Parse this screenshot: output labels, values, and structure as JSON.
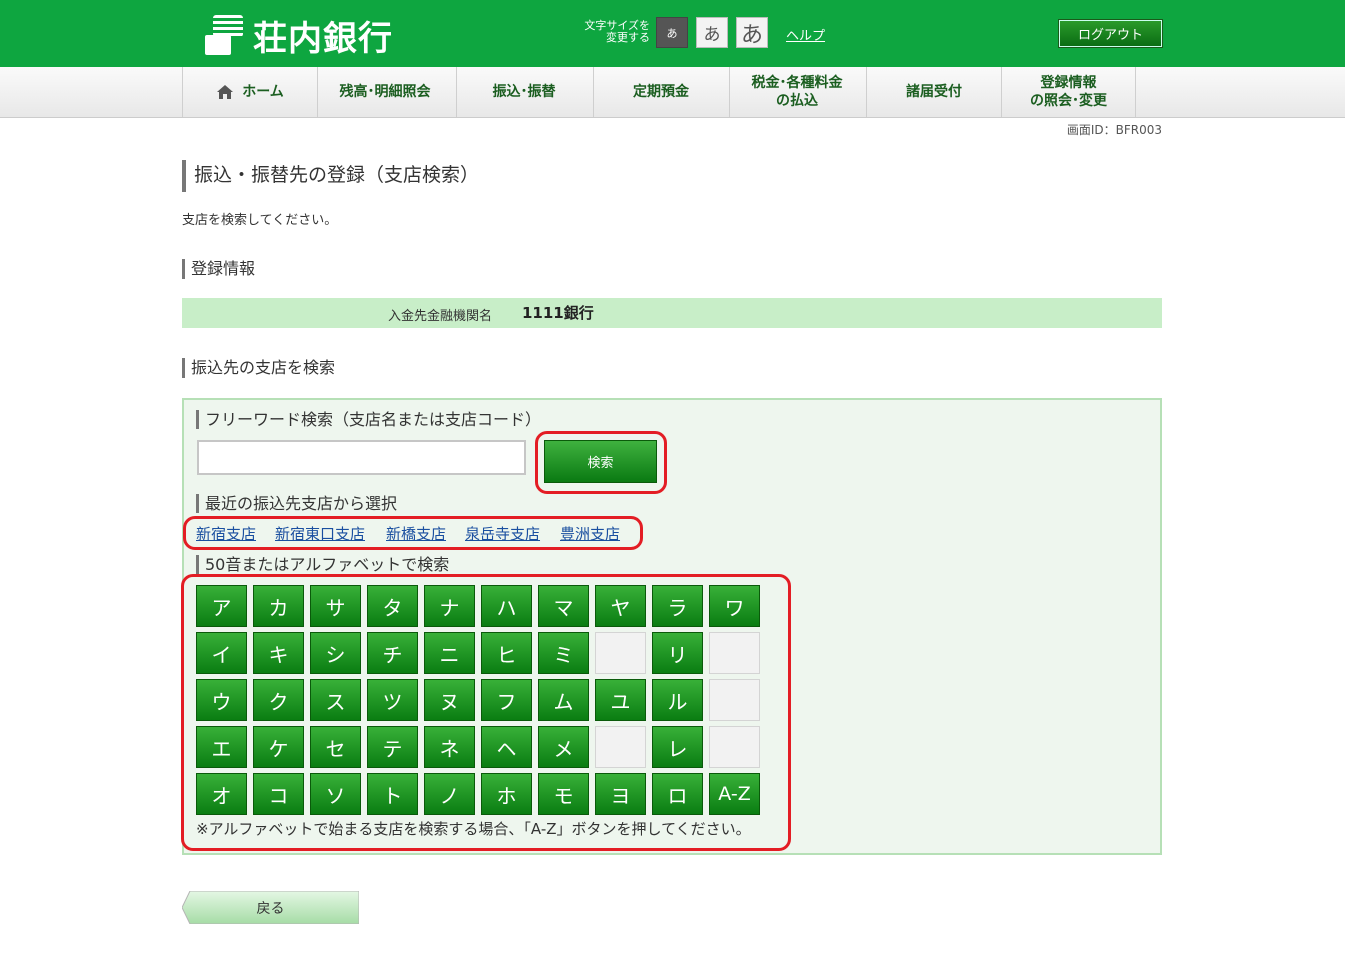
{
  "header": {
    "logo_text": "荘内銀行",
    "font_size_label_line1": "文字サイズを",
    "font_size_label_line2": "変更する",
    "font_small": "あ",
    "font_medium": "あ",
    "font_large": "あ",
    "help": "ヘルプ",
    "logout": "ログアウト",
    "bg_color": "#0ea640"
  },
  "nav": {
    "items": [
      {
        "label": "ホーム"
      },
      {
        "label": "残高･明細照会"
      },
      {
        "label": "振込･振替"
      },
      {
        "label": "定期預金"
      },
      {
        "label_line1": "税金･各種料金",
        "label_line2": "の払込"
      },
      {
        "label": "諸届受付"
      },
      {
        "label_line1": "登録情報",
        "label_line2": "の照会･変更"
      }
    ]
  },
  "screen_id": "画面ID：BFR003",
  "page_title": "振込・振替先の登録（支店検索）",
  "instruction": "支店を検索してください。",
  "registration": {
    "heading": "登録情報",
    "label": "入金先金融機関名",
    "value": "1111銀行"
  },
  "branch_search": {
    "heading": "振込先の支店を検索",
    "freeword_heading": "フリーワード検索（支店名または支店コード）",
    "freeword_value": "",
    "search_button": "検索",
    "recent_heading": "最近の振込先支店から選択",
    "recent_branches": [
      "新宿支店",
      "新宿東口支店",
      "新橋支店",
      "泉岳寺支店",
      "豊洲支店"
    ],
    "kana_heading": "50音またはアルファベットで検索",
    "kana_rows": [
      [
        "ア",
        "カ",
        "サ",
        "タ",
        "ナ",
        "ハ",
        "マ",
        "ヤ",
        "ラ",
        "ワ"
      ],
      [
        "イ",
        "キ",
        "シ",
        "チ",
        "ニ",
        "ヒ",
        "ミ",
        "",
        "リ",
        ""
      ],
      [
        "ウ",
        "ク",
        "ス",
        "ツ",
        "ヌ",
        "フ",
        "ム",
        "ユ",
        "ル",
        ""
      ],
      [
        "エ",
        "ケ",
        "セ",
        "テ",
        "ネ",
        "ヘ",
        "メ",
        "",
        "レ",
        ""
      ],
      [
        "オ",
        "コ",
        "ソ",
        "ト",
        "ノ",
        "ホ",
        "モ",
        "ヨ",
        "ロ",
        "A-Z"
      ]
    ],
    "note": "※アルファベットで始まる支店を検索する場合、「A-Z」ボタンを押してください。"
  },
  "back_button": "戻る",
  "colors": {
    "primary_green": "#0ea640",
    "panel_bg": "#eef6ee",
    "info_bar_bg": "#c8eec8",
    "annotation_red": "#e31d24",
    "link_blue": "#1a4fa0"
  }
}
